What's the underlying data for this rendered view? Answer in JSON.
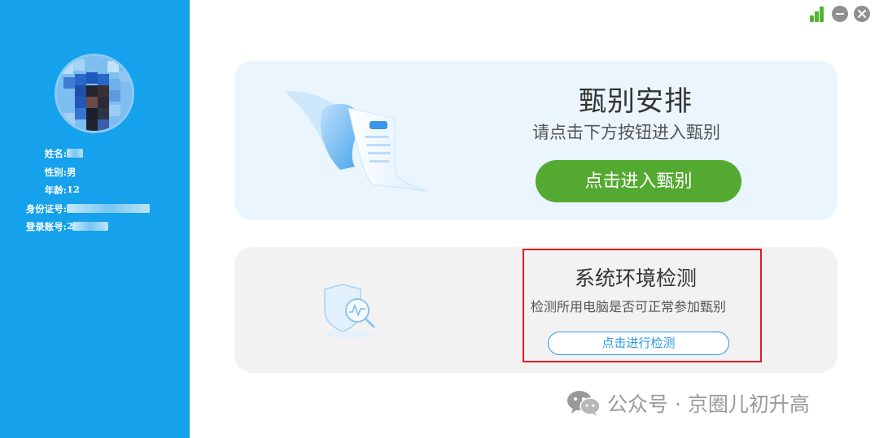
{
  "profile": {
    "fields": [
      {
        "label": "姓名:",
        "value": ""
      },
      {
        "label": "性别:",
        "value": "男"
      },
      {
        "label": "年龄:",
        "value": "12"
      },
      {
        "label": "身份证号:",
        "value": ""
      },
      {
        "label": "登录账号:",
        "value": "2"
      }
    ]
  },
  "exam_card": {
    "title": "甄别安排",
    "subtitle": "请点击下方按钮进入甄别",
    "button_label": "点击进入甄别"
  },
  "env_card": {
    "title": "系统环境检测",
    "subtitle": "检测所用电脑是否可正常参加甄别",
    "button_label": "点击进行检测"
  },
  "watermark": {
    "text": "公众号 · 京圈儿初升高"
  },
  "colors": {
    "sidebar": "#15a1ec",
    "primary_button": "#54a930",
    "detect_button": "#2b9be0",
    "highlight": "#e41e1e"
  },
  "icons": {
    "window": [
      "signal-icon",
      "minimize-icon",
      "close-icon"
    ],
    "illustrations": [
      "document-illustration-icon",
      "shield-scan-icon"
    ],
    "watermark": "wechat-icon"
  }
}
